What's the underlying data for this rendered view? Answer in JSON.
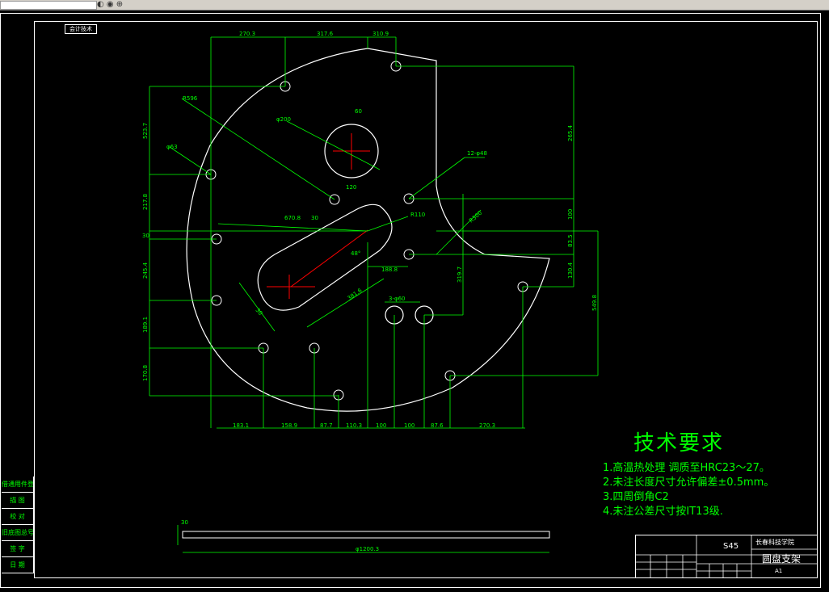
{
  "notes": {
    "title": "技术要求",
    "items": [
      "1.高温热处理 调质至HRC23～27。",
      "2.未注长度尺寸允许偏差±0.5mm。",
      "3.四周倒角C2",
      "4.未注公差尺寸按IT13级."
    ]
  },
  "title_block": {
    "material": "S45",
    "school": "长春科技学院",
    "part_name": "圆盘支架",
    "sheet": "A1"
  },
  "top_label": "会计技术",
  "side_labels": [
    "借通用件登记",
    "描 图",
    "校 对",
    "旧底图总号",
    "签 字",
    "日 期"
  ],
  "dimensions": {
    "top": [
      "270.3",
      "317.6",
      "310.9"
    ],
    "bottom": [
      "183.1",
      "158.9",
      "87.7",
      "110.3",
      "100",
      "100",
      "87.6",
      "270.3"
    ],
    "left": [
      "523.7",
      "217.8",
      "30",
      "245.4",
      "189.1",
      "170.8"
    ],
    "right": [
      "265.4",
      "100",
      "83.5",
      "130.4",
      "319.7",
      "549.8"
    ],
    "misc": [
      "R596",
      "φ63",
      "φ200",
      "60",
      "120",
      "12-φ48",
      "670.8",
      "30",
      "R110",
      "R300",
      "48°",
      "188.8",
      "30",
      "381.6",
      "3-φ60",
      "R80"
    ],
    "side_view_thickness": "30",
    "side_view_length": "φ1200.3"
  },
  "colors": {
    "background": "#000000",
    "outline": "#ffffff",
    "dimension": "#00ff00",
    "centerline": "#ff0000"
  }
}
